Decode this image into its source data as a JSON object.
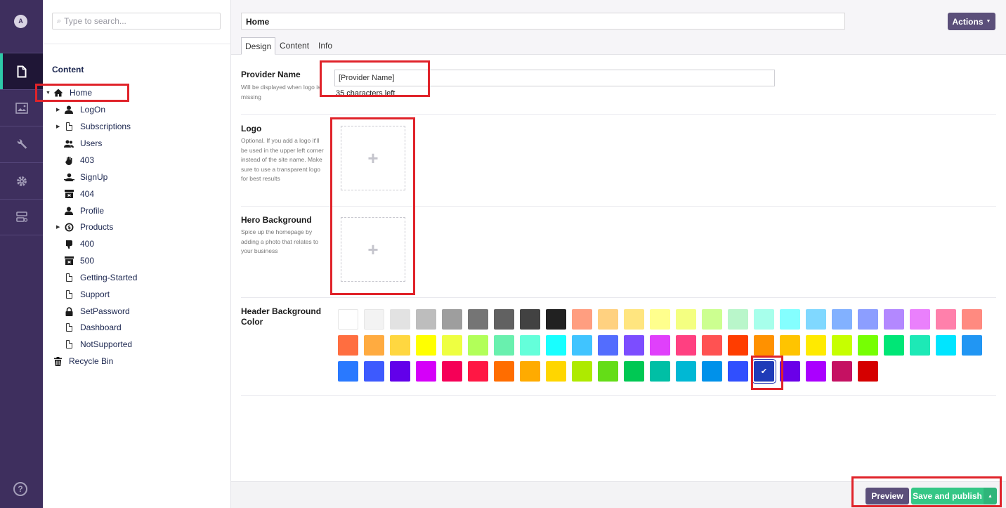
{
  "rail": {
    "avatar_initial": "A",
    "sections": [
      "content-section",
      "media-section",
      "settings-section",
      "gear-section",
      "forms-section"
    ],
    "help_symbol": "?"
  },
  "tree": {
    "search_placeholder": "Type to search...",
    "title": "Content",
    "root": "Home",
    "items": [
      {
        "label": "LogOn",
        "icon": "user-icon",
        "expandable": true
      },
      {
        "label": "Subscriptions",
        "icon": "document-icon",
        "expandable": true
      },
      {
        "label": "Users",
        "icon": "users-icon",
        "expandable": false
      },
      {
        "label": "403",
        "icon": "hand-icon",
        "expandable": false
      },
      {
        "label": "SignUp",
        "icon": "user-add-icon",
        "expandable": false
      },
      {
        "label": "404",
        "icon": "box-icon",
        "expandable": false
      },
      {
        "label": "Profile",
        "icon": "user-icon",
        "expandable": false
      },
      {
        "label": "Products",
        "icon": "coin-icon",
        "expandable": true
      },
      {
        "label": "400",
        "icon": "thumb-down-icon",
        "expandable": false
      },
      {
        "label": "500",
        "icon": "box-icon",
        "expandable": false
      },
      {
        "label": "Getting-Started",
        "icon": "document-icon",
        "expandable": false
      },
      {
        "label": "Support",
        "icon": "document-icon",
        "expandable": false
      },
      {
        "label": "SetPassword",
        "icon": "lock-icon",
        "expandable": false
      },
      {
        "label": "Dashboard",
        "icon": "document-icon",
        "expandable": false
      },
      {
        "label": "NotSupported",
        "icon": "document-icon",
        "expandable": false
      }
    ],
    "recycle_bin": "Recycle Bin"
  },
  "editor": {
    "node_name": "Home",
    "actions_label": "Actions",
    "tabs": [
      "Design",
      "Content",
      "Info"
    ],
    "provider_name": {
      "label": "Provider Name",
      "description": "Will be displayed when logo is missing",
      "value": "[Provider Name]",
      "counter": "35 characters left"
    },
    "logo": {
      "label": "Logo",
      "description": "Optional. If you add a logo it'll be used in the upper left corner instead of the site name. Make sure to use a transparent logo for best results"
    },
    "hero_background": {
      "label": "Hero Background",
      "description": "Spice up the homepage by adding a photo that relates to your business"
    },
    "header_background_color": {
      "label": "Header Background Color",
      "selected": "#1f3bb8",
      "rows": [
        [
          "#ffffff",
          "#f3f3f3",
          "#e2e2e2",
          "#bdbdbd",
          "#9e9e9e",
          "#757575",
          "#616161",
          "#424242",
          "#212121",
          "#ff9e80",
          "#ffd180",
          "#ffe57f",
          "#ffff8d",
          "#f4ff81",
          "#ccff90",
          "#b9f6ca",
          "#a7ffeb",
          "#84ffff",
          "#80d8ff",
          "#82b1ff",
          "#8c9eff",
          "#b388ff",
          "#ea80fc",
          "#ff80ab",
          "#ff8a80"
        ],
        [
          "#ff6e40",
          "#ffab40",
          "#ffd740",
          "#ffff00",
          "#eeff41",
          "#b2ff59",
          "#69f0ae",
          "#64ffda",
          "#18ffff",
          "#40c4ff",
          "#536dfe",
          "#7c4dff",
          "#e040fb",
          "#ff4081",
          "#ff5252",
          "#ff3d00",
          "#ff9100",
          "#ffc400",
          "#ffea00",
          "#c6ff00",
          "#76ff03",
          "#00e676",
          "#1de9b6",
          "#00e5ff",
          "#2196f3"
        ],
        [
          "#2979ff",
          "#3d5afe",
          "#6200ea",
          "#d500f9",
          "#f50057",
          "#ff1744",
          "#ff6d00",
          "#ffab00",
          "#ffd600",
          "#aeea00",
          "#64dd17",
          "#00c853",
          "#00bfa5",
          "#00b8d4",
          "#0091ea",
          "#304ffe",
          "#1f3bb8",
          "#6a00e8",
          "#aa00ff",
          "#c51162",
          "#d50000"
        ]
      ]
    }
  },
  "footer": {
    "preview_label": "Preview",
    "save_label": "Save and publish"
  }
}
